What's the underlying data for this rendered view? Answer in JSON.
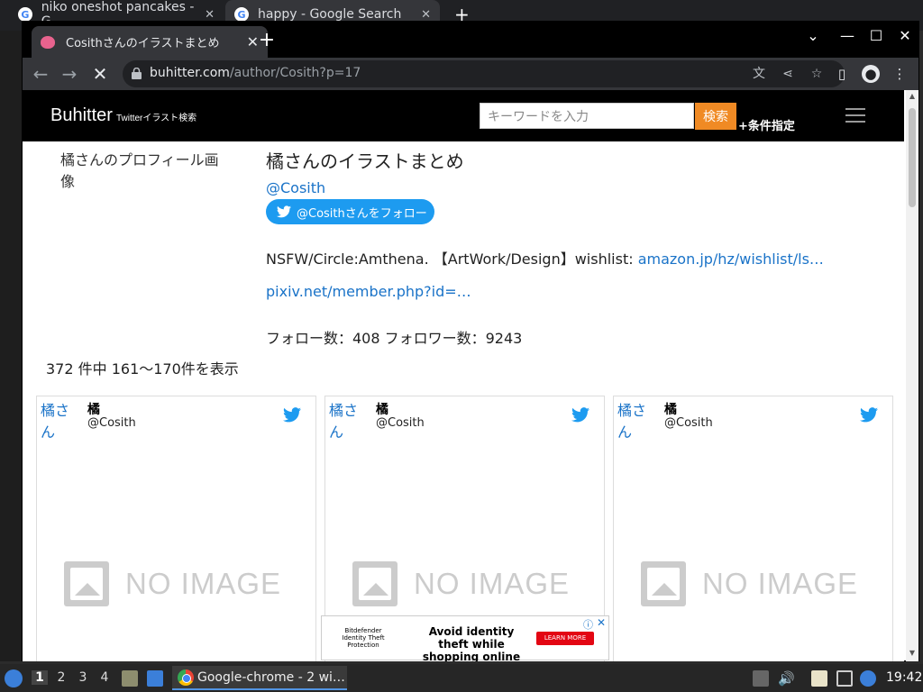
{
  "background_window": {
    "tabs": [
      {
        "title": "niko oneshot pancakes - G",
        "close": "✕"
      },
      {
        "title": "happy - Google Search",
        "close": "✕"
      }
    ],
    "new_tab": "+"
  },
  "browser": {
    "tab_title": "Cosithさんのイラストまとめ",
    "tab_close": "✕",
    "new_tab": "+",
    "url_host": "buhitter.com",
    "url_path": "/author/Cosith?p=17"
  },
  "site": {
    "brand": "Buhitter",
    "brand_sub": "Twitterイラスト検索",
    "search": {
      "placeholder": "キーワードを入力",
      "button": "検索"
    },
    "advanced": "+条件指定"
  },
  "profile": {
    "image_alt": "橘さんのプロフィール画像",
    "title": "橘さんのイラストまとめ",
    "handle": "@Cosith",
    "follow_button": "@Cosithさんをフォロー",
    "bio_text": "NSFW/Circle:Amthena. 【ArtWork/Design】wishlist: ",
    "bio_link": "amazon.jp/hz/wishlist/ls…",
    "pixiv_link": "pixiv.net/member.php?id=…",
    "stats": "フォロー数：408 フォロワー数：9243"
  },
  "result_count": "372 件中 161〜170件を表示",
  "cards": [
    {
      "avatar_alt": "橘さん",
      "name": "橘",
      "handle": "@Cosith",
      "no_image": "NO IMAGE"
    },
    {
      "avatar_alt": "橘さん",
      "name": "橘",
      "handle": "@Cosith",
      "no_image": "NO IMAGE"
    },
    {
      "avatar_alt": "橘さん",
      "name": "橘",
      "handle": "@Cosith",
      "no_image": "NO IMAGE"
    }
  ],
  "ad": {
    "brand": "Bitdefender Identity Theft Protection",
    "text": "Avoid identity theft while shopping online",
    "cta": "LEARN MORE",
    "info": "ⓘ",
    "close": "✕",
    "dismiss": "✕"
  },
  "taskbar": {
    "workspaces": [
      "1",
      "2",
      "3",
      "4"
    ],
    "task_label": "Google-chrome - 2 wi…",
    "clock": "19:42"
  },
  "colors": {
    "accent_orange": "#f08a24",
    "twitter_blue": "#1d9bf0",
    "link_blue": "#1a73c8"
  }
}
